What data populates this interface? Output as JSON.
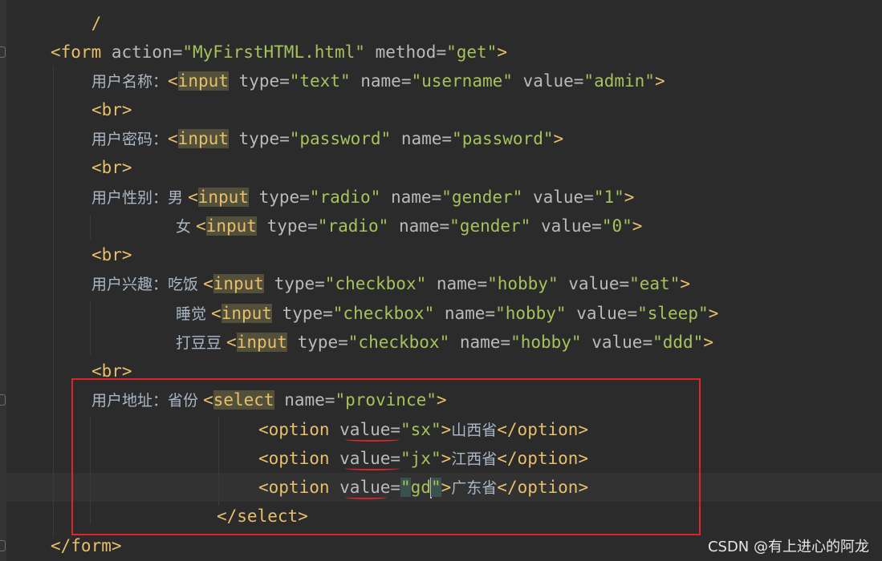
{
  "watermark": "CSDN @有上进心的阿龙",
  "code": {
    "top_fragment": "/",
    "form_open": {
      "tag_open": "<form",
      "attr1": " action=",
      "val1": "\"MyFirstHTML.html\"",
      "attr2": " method=",
      "val2": "\"get\"",
      "close": ">"
    },
    "username": {
      "label": "用户名称：",
      "lt": "<",
      "tag": "input",
      "attr1": " type=",
      "val1": "\"text\"",
      "attr2": " name=",
      "val2": "\"username\"",
      "attr3": " value=",
      "val3": "\"admin\"",
      "close": ">"
    },
    "br1": "<br>",
    "password": {
      "label": "用户密码：",
      "lt": "<",
      "tag": "input",
      "attr1": " type=",
      "val1": "\"password\"",
      "attr2": " name=",
      "val2": "\"password\"",
      "close": ">"
    },
    "br2": "<br>",
    "gender_male": {
      "label": "用户性别：",
      "option": "男 ",
      "lt": "<",
      "tag": "input",
      "attr1": " type=",
      "val1": "\"radio\"",
      "attr2": " name=",
      "val2": "\"gender\"",
      "attr3": " value=",
      "val3": "\"1\"",
      "close": ">"
    },
    "gender_female": {
      "option": "女 ",
      "lt": "<",
      "tag": "input",
      "attr1": " type=",
      "val1": "\"radio\"",
      "attr2": " name=",
      "val2": "\"gender\"",
      "attr3": " value=",
      "val3": "\"0\"",
      "close": ">"
    },
    "br3": "<br>",
    "hobby_eat": {
      "label": "用户兴趣：",
      "option": "吃饭 ",
      "lt": "<",
      "tag": "input",
      "attr1": " type=",
      "val1": "\"checkbox\"",
      "attr2": " name=",
      "val2": "\"hobby\"",
      "attr3": " value=",
      "val3": "\"eat\"",
      "close": ">"
    },
    "hobby_sleep": {
      "option": "睡觉 ",
      "lt": "<",
      "tag": "input",
      "attr1": " type=",
      "val1": "\"checkbox\"",
      "attr2": " name=",
      "val2": "\"hobby\"",
      "attr3": " value=",
      "val3": "\"sleep\"",
      "close": ">"
    },
    "hobby_ddd": {
      "option": "打豆豆 ",
      "lt": "<",
      "tag": "input",
      "attr1": " type=",
      "val1": "\"checkbox\"",
      "attr2": " name=",
      "val2": "\"hobby\"",
      "attr3": " value=",
      "val3": "\"ddd\"",
      "close": ">"
    },
    "br4": "<br>",
    "select_open": {
      "label": "用户地址：",
      "option": "省份 ",
      "lt": "<",
      "tag": "select",
      "attr1": " name=",
      "val1": "\"province\"",
      "close": ">"
    },
    "option_sx": {
      "tag_open": "<option ",
      "attr": "value=",
      "val": "\"sx\"",
      "close": ">",
      "text": "山西省",
      "end": "</option>"
    },
    "option_jx": {
      "tag_open": "<option ",
      "attr": "value=",
      "val": "\"jx\"",
      "close": ">",
      "text": "江西省",
      "end": "</option>"
    },
    "option_gd": {
      "tag_open": "<option ",
      "attr": "value=",
      "q1": "\"",
      "inner": "gd",
      "q2": "\"",
      "close": ">",
      "text": "广东省",
      "end": "</option>"
    },
    "select_close": "</select>",
    "form_close": "</form>"
  }
}
